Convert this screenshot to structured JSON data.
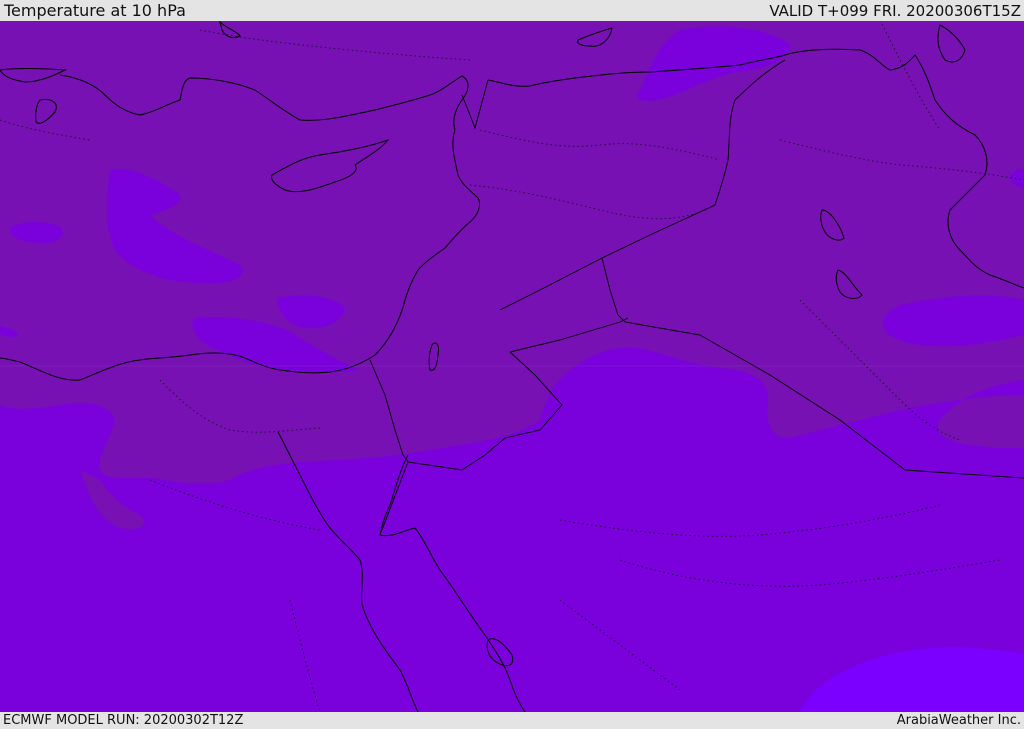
{
  "header": {
    "title": "Temperature at 10 hPa",
    "valid": "VALID T+099 FRI. 20200306T15Z"
  },
  "footer": {
    "model_run": "ECMWF MODEL RUN: 20200302T12Z",
    "credit": "ArabiaWeather Inc."
  },
  "colors": {
    "band_warm": "#7711b3",
    "band_mid": "#7a00dc",
    "band_cold": "#7b00ff",
    "coastline": "#000000",
    "background": "#e4e4e4"
  },
  "legend": {
    "band_warm": "dark purple",
    "band_mid": "purple",
    "band_cold": "violet"
  }
}
